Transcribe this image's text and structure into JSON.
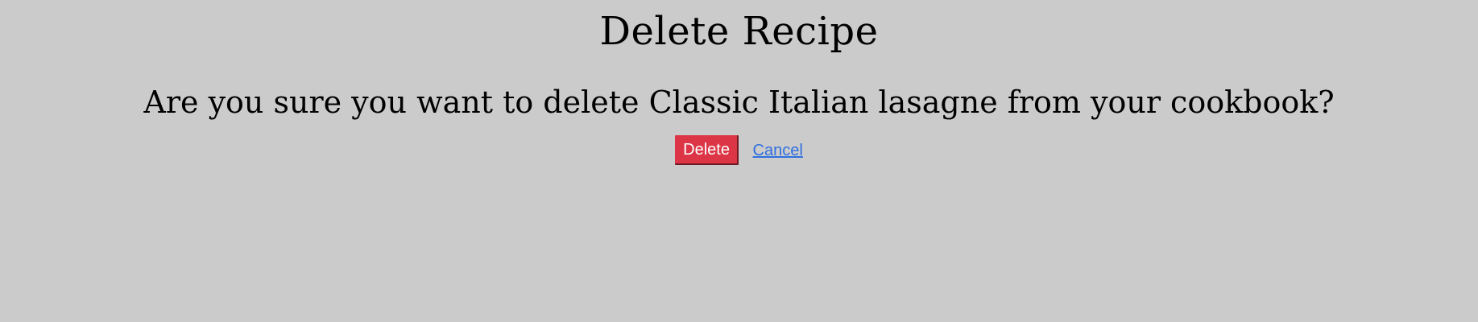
{
  "page": {
    "title": "Delete Recipe",
    "message": "Are you sure you want to delete Classic Italian lasagne from your cookbook?"
  },
  "actions": {
    "delete_label": "Delete",
    "cancel_label": "Cancel"
  },
  "colors": {
    "background": "#cbcbcb",
    "delete_button": "#dc3545",
    "link": "#2f6fe0"
  }
}
